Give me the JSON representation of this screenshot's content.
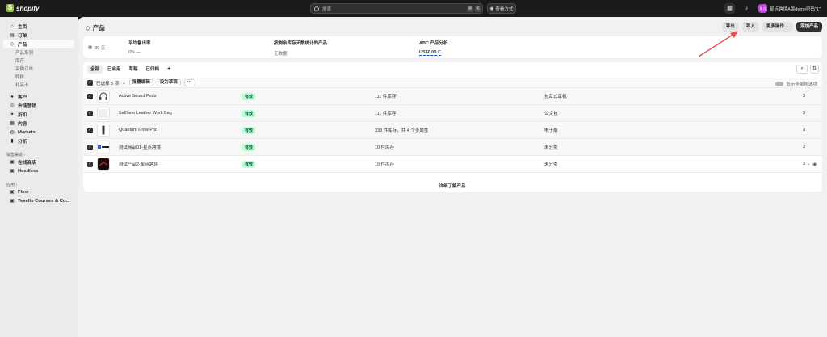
{
  "topbar": {
    "brand": "shopify",
    "search_placeholder": "搜索",
    "kbd1": "⌘",
    "kbd2": "K",
    "view_mode": "查看方式",
    "avatar": "星点",
    "store_name": "星点跨境A版demo密码\"1\""
  },
  "sidebar": {
    "items": [
      {
        "label": "主页",
        "icon": "⌂"
      },
      {
        "label": "订单",
        "icon": "▤"
      },
      {
        "label": "产品",
        "icon": "◇"
      }
    ],
    "sub_items": [
      "产品系列",
      "库存",
      "采购订单",
      "转移",
      "礼品卡"
    ],
    "items2": [
      {
        "label": "客户",
        "icon": "●"
      },
      {
        "label": "市场营销",
        "icon": "◎"
      },
      {
        "label": "折扣",
        "icon": "✦"
      },
      {
        "label": "内容",
        "icon": "▦"
      },
      {
        "label": "Markets",
        "icon": "◍"
      },
      {
        "label": "分析",
        "icon": "▮"
      }
    ],
    "section1": "销售渠道",
    "channels": [
      {
        "label": "在线商店",
        "icon": "▣"
      },
      {
        "label": "Headless",
        "icon": "▣"
      }
    ],
    "section2": "应用",
    "apps": [
      {
        "label": "Flow",
        "icon": "▣"
      },
      {
        "label": "Tevello Courses & Co...",
        "icon": "▣"
      }
    ]
  },
  "page": {
    "title": "产品",
    "actions": {
      "export": "导出",
      "import": "导入",
      "more": "更多操作",
      "add": "添加产品"
    }
  },
  "stats": {
    "days": "30 天",
    "s1_label": "平均售出率",
    "s1_value": "0% —",
    "s2_label": "按剩余库存天数统计的产品",
    "s2_value": "无数据",
    "s3_label": "ABC 产品分析",
    "s3_value": "US$0.00",
    "s3_suffix": "C"
  },
  "tabs": [
    "全部",
    "已启用",
    "草稿",
    "已归档",
    "+"
  ],
  "bulk": {
    "selected": "已选择 5 项",
    "bulk_edit": "批量编辑",
    "set_draft": "设为草稿",
    "more": "•••",
    "show_all": "显示全部所选项"
  },
  "products": [
    {
      "name": "Active Sound Pods",
      "status": "有效",
      "stock": "111 件库存",
      "type": "包耳式耳机",
      "markets": "3"
    },
    {
      "name": "Saffiano Leather Work Bag",
      "status": "有效",
      "stock": "111 件库存",
      "type": "公文包",
      "markets": "3"
    },
    {
      "name": "Quantum Glow Pod",
      "status": "有效",
      "stock": "333 件库存，共 4 个多属性",
      "type": "电子烟",
      "markets": "3"
    },
    {
      "name": "测试商品01-星点跨境",
      "status": "有效",
      "stock": "10 件库存",
      "type": "未分类",
      "markets": "3"
    },
    {
      "name": "测试产品2-星点跨境",
      "status": "有效",
      "stock": "10 件库存",
      "type": "未分类",
      "markets": "3 ⌄"
    }
  ],
  "footer": {
    "learn_more": "详细了解产品"
  },
  "colors": {
    "accent_green": "#b4fed2",
    "annotation_arrow": "#e8504a"
  }
}
